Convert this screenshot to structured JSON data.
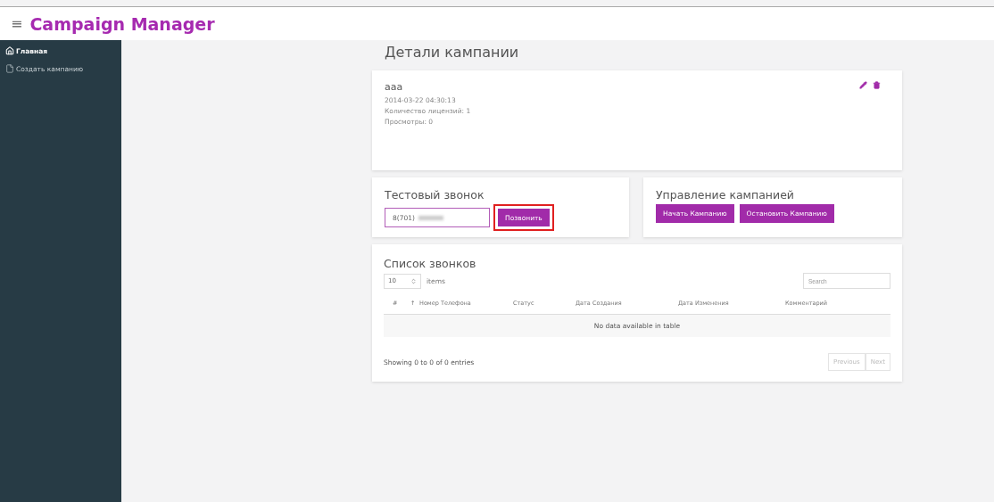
{
  "header": {
    "menu_glyph": "≡",
    "title": "Campaign Manager"
  },
  "sidebar": {
    "items": [
      {
        "label": "Главная",
        "kind": "home",
        "selected": true
      },
      {
        "label": "Создать кампанию",
        "kind": "file",
        "selected": false
      }
    ]
  },
  "page_title": "Детали кампании",
  "campaign": {
    "name": "aaa",
    "date": "2014-03-22 04:30:13",
    "licenses": "Количество лицензий: 1",
    "views": "Просмотры: 0"
  },
  "test_call": {
    "title": "Тестовый звонок",
    "phone_value": "8(701)",
    "call_button": {
      "label": "Позвонить",
      "highlighted": true
    }
  },
  "control": {
    "title": "Управление кампанией",
    "buttons": [
      "Начать Кампанию",
      "Остановить Кампанию"
    ]
  },
  "calls": {
    "title": "Список звонков",
    "page_size": "10",
    "page_size_label": "items",
    "search_placeholder": "Search",
    "columns": [
      "#",
      "↑",
      "Номер Телефона",
      "Статус",
      "Дата Создания",
      "Дата Изменения",
      "Комментарий"
    ],
    "empty_message": "No data available in table",
    "info": "Showing 0 to 0 of 0 entries",
    "pagination": [
      {
        "label": "Previous",
        "disabled": true
      },
      {
        "label": "Next",
        "disabled": true
      }
    ]
  }
}
